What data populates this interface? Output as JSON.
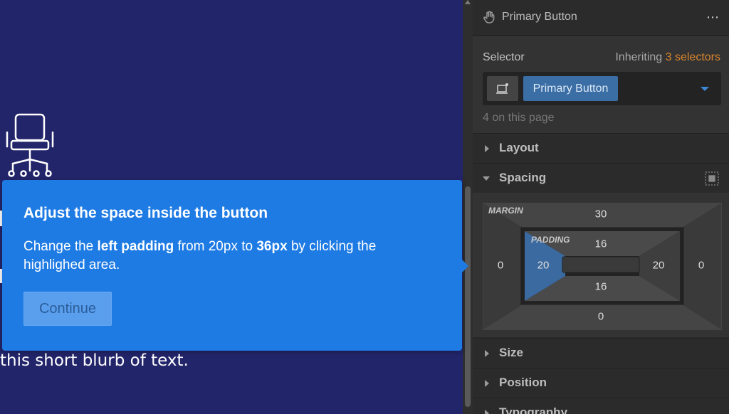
{
  "canvas": {
    "blurb_text": "this short blurb of text.",
    "background": "#23256b"
  },
  "tooltip": {
    "title": "Adjust the space inside the button",
    "body_pre": "Change the ",
    "body_bold1": "left padding",
    "body_mid": " from 20px to ",
    "body_bold2": "36px",
    "body_post": " by clicking the highlighed area.",
    "continue_label": "Continue",
    "color": "#1e7be4"
  },
  "panel": {
    "element_name": "Primary Button",
    "more_icon": "⋯",
    "selector": {
      "label": "Selector",
      "inherit_prefix": "Inheriting ",
      "inherit_count": "3 selectors",
      "chip_label": "Primary Button",
      "on_page": "4 on this page"
    },
    "sections": {
      "layout": "Layout",
      "spacing": "Spacing",
      "size": "Size",
      "position": "Position",
      "typography": "Typography"
    },
    "spacing_model": {
      "margin_label": "MARGIN",
      "padding_label": "PADDING",
      "margin_top": "30",
      "margin_right": "0",
      "margin_bottom": "0",
      "margin_left": "0",
      "padding_top": "16",
      "padding_right": "20",
      "padding_bottom": "16",
      "padding_left": "20"
    },
    "accent_orange": "#d8852f",
    "accent_blue": "#3a6ea5"
  }
}
